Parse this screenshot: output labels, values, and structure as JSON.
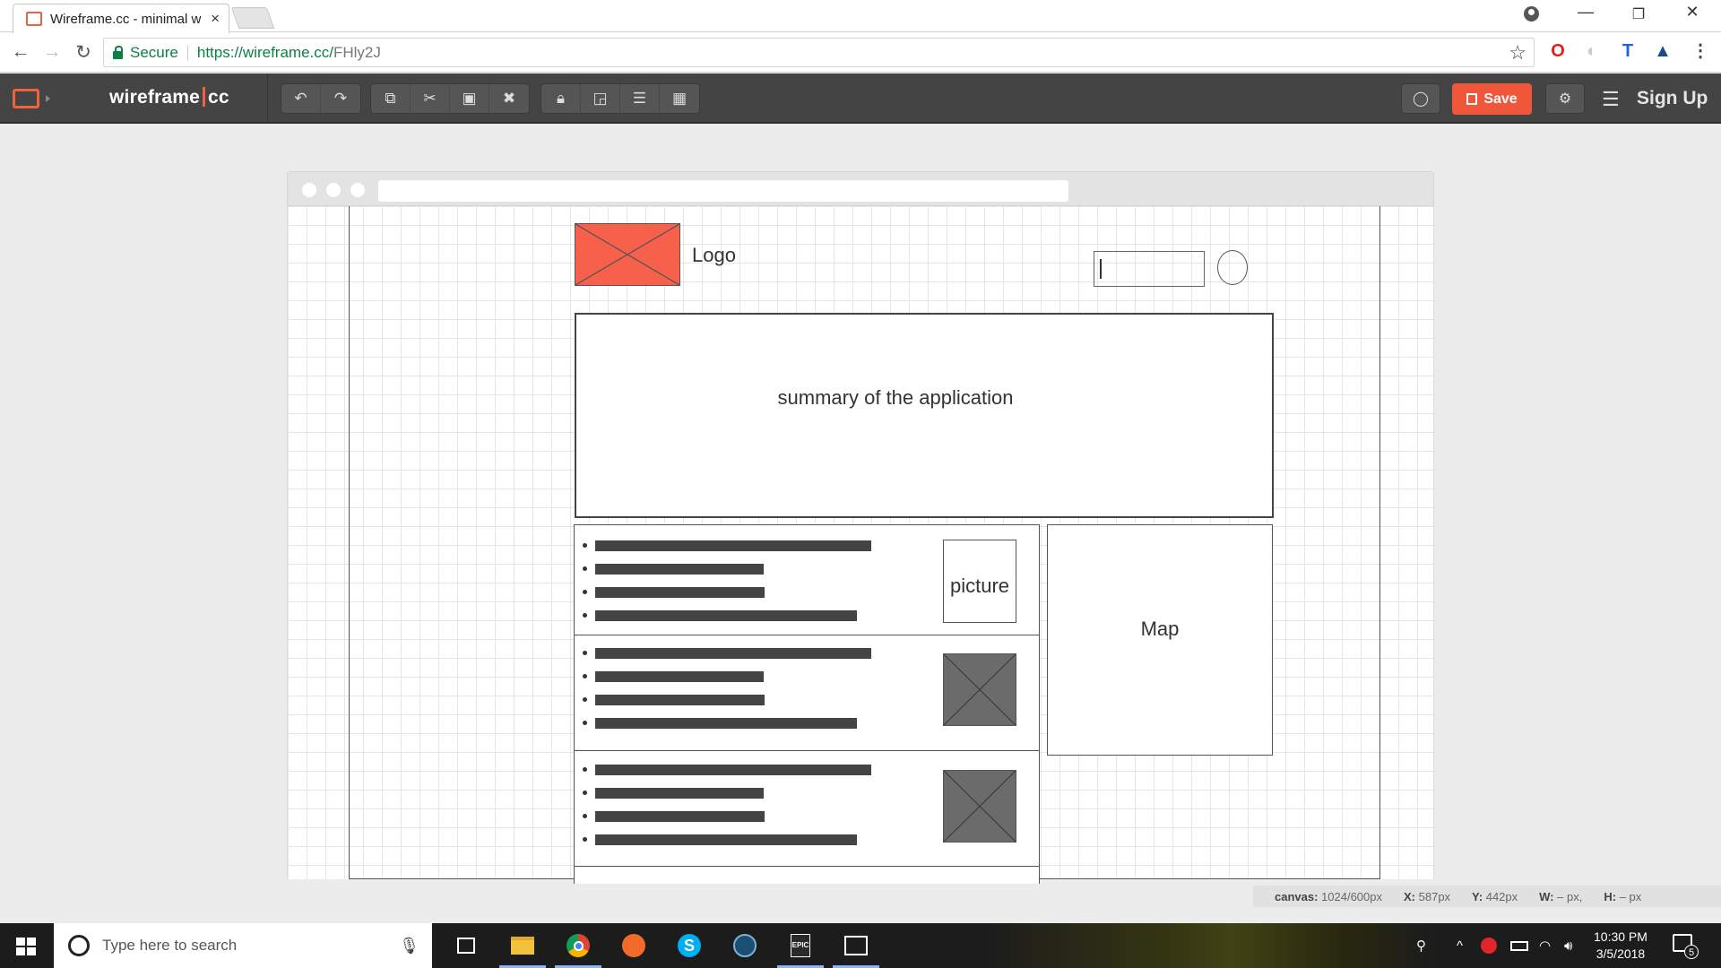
{
  "browser": {
    "tab_title": "Wireframe.cc - minimal w",
    "tab_close": "×",
    "secure_label": "Secure",
    "url_host": "https://wireframe.cc/",
    "url_path": "FHly2J",
    "window_controls": [
      "—",
      "❐",
      "✕"
    ]
  },
  "app": {
    "brand_left": "wireframe",
    "brand_right": "cc",
    "save_label": "Save",
    "signup_label": "Sign Up",
    "toolbar_groups": [
      [
        "undo-icon",
        "redo-icon"
      ],
      [
        "copy-icon",
        "cut-icon",
        "paste-icon",
        "delete-icon"
      ],
      [
        "lock-icon",
        "arrange-icon",
        "align-icon",
        "group-icon"
      ]
    ]
  },
  "wireframe": {
    "logo_label": "Logo",
    "summary_text": "summary of the application",
    "picture_label": "picture",
    "map_label": "Map",
    "list_cards": 3
  },
  "statusbar": {
    "canvas_key": "canvas:",
    "canvas_val": "1024/600px",
    "x_key": "X:",
    "x_val": "587px",
    "y_key": "Y:",
    "y_val": "442px",
    "w_key": "W:",
    "w_val": "– px,",
    "h_key": "H:",
    "h_val": "– px"
  },
  "taskbar": {
    "search_placeholder": "Type here to search",
    "time": "10:30 PM",
    "date": "3/5/2018",
    "notification_count": "5"
  },
  "colors": {
    "accent": "#f0563a",
    "toolbar_bg": "#444444",
    "secure_green": "#0b8043"
  }
}
